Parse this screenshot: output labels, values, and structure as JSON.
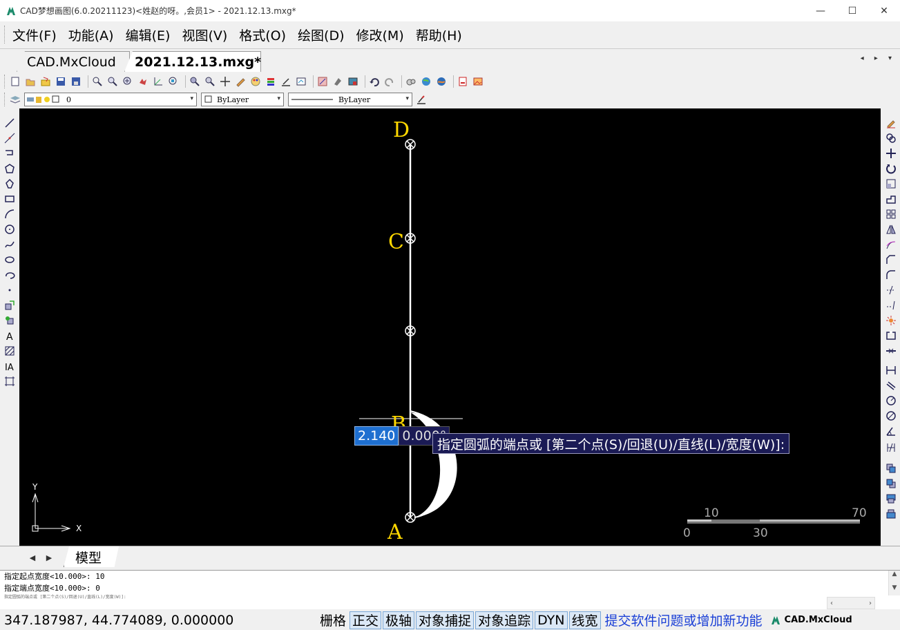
{
  "window": {
    "title": "CAD梦想画图(6.0.20211123)<姓赵的呀。,会员1> - 2021.12.13.mxg*",
    "minimize": "—",
    "maximize": "☐",
    "close": "✕"
  },
  "menu": [
    "文件(F)",
    "功能(A)",
    "编辑(E)",
    "视图(V)",
    "格式(O)",
    "绘图(D)",
    "修改(M)",
    "帮助(H)"
  ],
  "tabs": {
    "inactive": "CAD.MxCloud",
    "active": "2021.12.13.mxg*",
    "arrows": "◂ ▸ ▾"
  },
  "layer_toolbar": {
    "layer_value": "0",
    "color_value": "ByLayer",
    "linetype_value": "ByLayer"
  },
  "drawing": {
    "labels": {
      "D": "D",
      "C": "C",
      "B": "B",
      "A": "A"
    },
    "axis_y": "Y",
    "axis_x": "X",
    "scale": {
      "top_left": "10",
      "top_right": "70",
      "bottom_left": "0",
      "bottom_mid": "30"
    }
  },
  "dyn": {
    "value": "2.140",
    "angle": "0.000°",
    "prompt": "指定圆弧的端点或 [第二个点(S)/回退(U)/直线(L)/宽度(W)]:"
  },
  "layout": {
    "model_tab": "模型",
    "prev": "◀",
    "next": "▶"
  },
  "command_history": [
    "指定起点宽度<10.000>: 10",
    "指定端点宽度<10.000>: 0",
    "指定圆弧的端点或 [第二个点(S)/回退(U)/直线(L)/宽度(W)]:"
  ],
  "status": {
    "coords": "347.187987,  44.774089,  0.000000",
    "buttons": [
      {
        "label": "栅格",
        "on": false
      },
      {
        "label": "正交",
        "on": true
      },
      {
        "label": "极轴",
        "on": true
      },
      {
        "label": "对象捕捉",
        "on": true
      },
      {
        "label": "对象追踪",
        "on": true
      },
      {
        "label": "DYN",
        "on": true
      },
      {
        "label": "线宽",
        "on": true
      }
    ],
    "link": "提交软件问题或增加新功能",
    "brand": "CAD.MxCloud"
  },
  "colors": {
    "canvas": "#000000",
    "label_yellow": "#ffd800",
    "accent_blue": "#1e6fd0"
  }
}
